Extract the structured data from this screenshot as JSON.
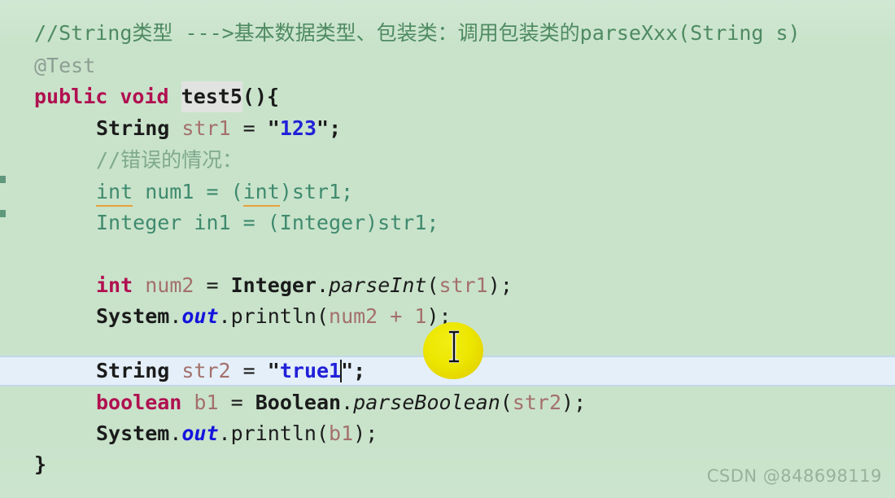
{
  "editor": {
    "background_color": "#c9e3cb",
    "current_line_color": "#e4eff9",
    "watermark": "CSDN @848698119",
    "pointer": {
      "icon": "text-ibeam-cursor",
      "highlight_color": "#ece600"
    },
    "gutter_marks": 2
  },
  "code": {
    "lines": [
      {
        "id": "line-comment-header",
        "text": "//String类型 --->基本数据类型、包装类：调用包装类的parseXxx(String s)"
      },
      {
        "id": "line-annotation-test",
        "text": "@Test"
      },
      {
        "id": "line-method-signature",
        "keyword_public": "public",
        "keyword_void": "void",
        "method_name": "test5",
        "tail": "(){"
      },
      {
        "id": "line-str1-decl",
        "type": "String",
        "name": "str1",
        "assign": "=",
        "value": "123"
      },
      {
        "id": "line-comment-error-case",
        "text": "//错误的情况："
      },
      {
        "id": "line-bad-int-cast",
        "text": "int num1 = (int)str1;"
      },
      {
        "id": "line-bad-integer-cast",
        "text": "Integer in1 = (Integer)str1;"
      },
      {
        "id": "line-num2-parseint",
        "keyword": "int",
        "name": "num2",
        "assign": "=",
        "receiver": "Integer",
        "method": "parseInt",
        "arg": "str1"
      },
      {
        "id": "line-println-num2",
        "receiver": "System",
        "field": "out",
        "method": "println",
        "arg": "num2 + 1"
      },
      {
        "id": "line-str2-decl",
        "type": "String",
        "name": "str2",
        "assign": "=",
        "value": "true1",
        "is_current_line": true,
        "has_caret": true
      },
      {
        "id": "line-b1-parseboolean",
        "keyword": "boolean",
        "name": "b1",
        "assign": "=",
        "receiver": "Boolean",
        "method": "parseBoolean",
        "arg": "str2"
      },
      {
        "id": "line-println-b1",
        "receiver": "System",
        "field": "out",
        "method": "println",
        "arg": "b1"
      },
      {
        "id": "line-closing-brace",
        "text": "}"
      }
    ],
    "tokens": {
      "semicolon": ";",
      "dot": ".",
      "lparen": "(",
      "rparen": ")",
      "quote": "\"",
      "assign": "=",
      "lbrace": "{",
      "rbrace": "}",
      "method_suffix": "(){"
    }
  }
}
